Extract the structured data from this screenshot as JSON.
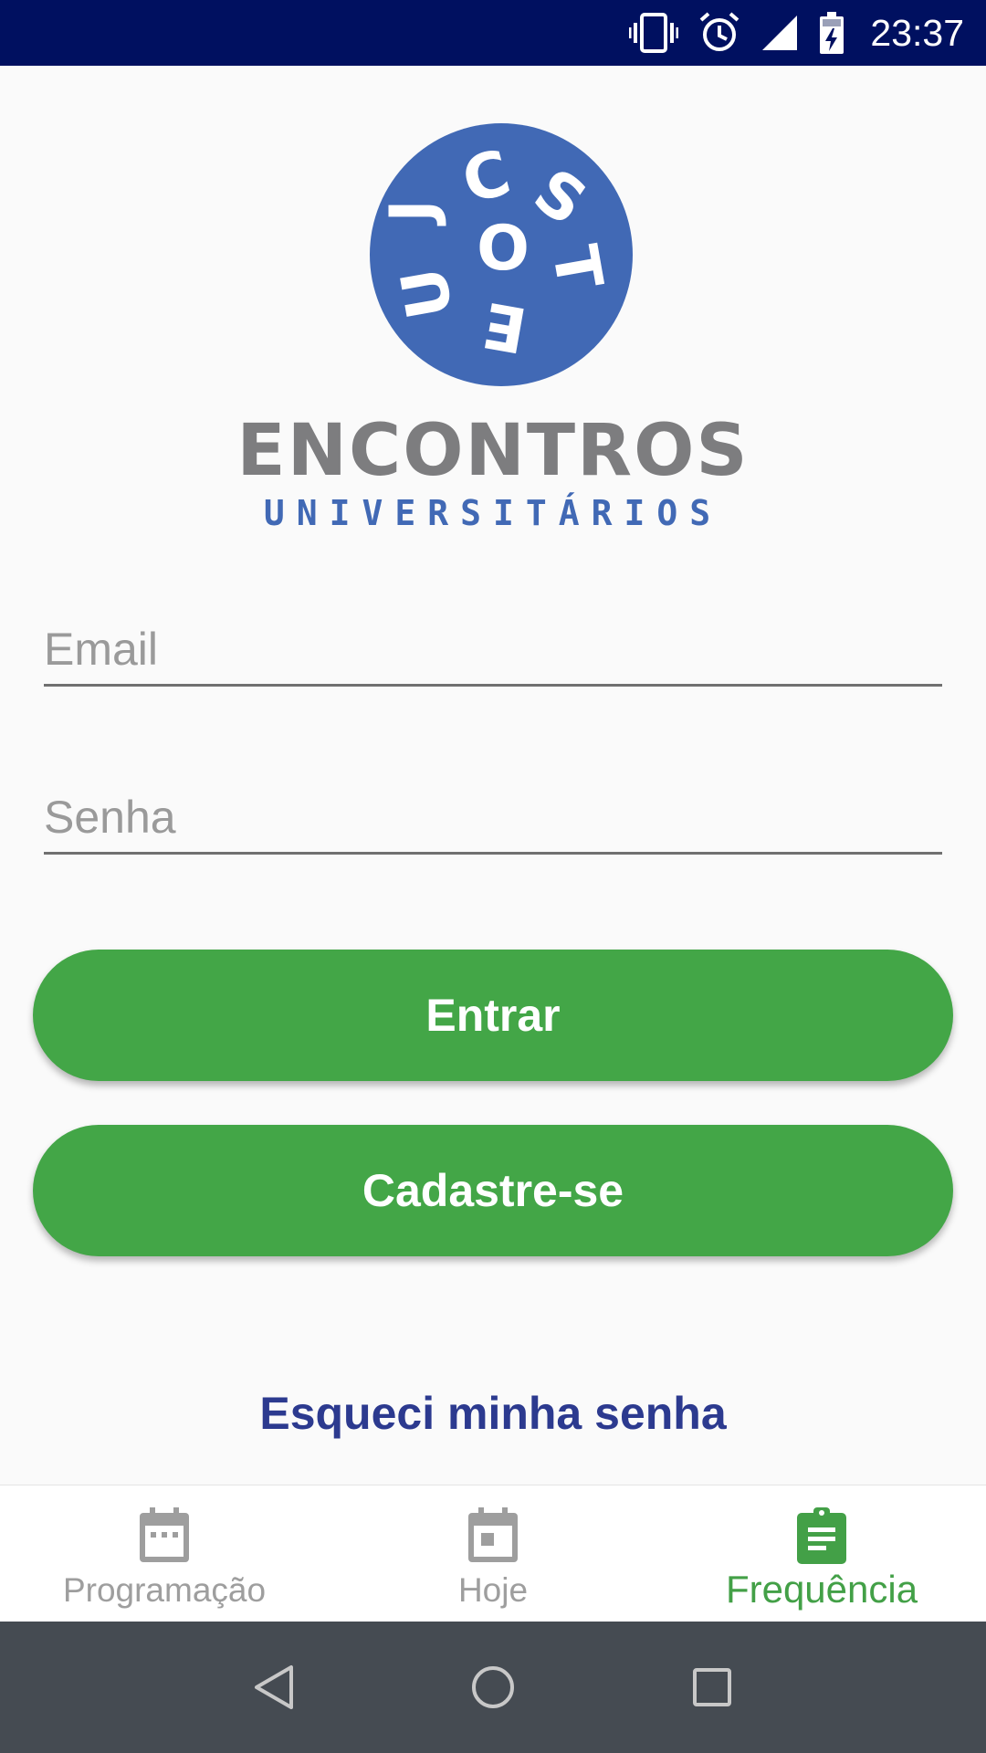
{
  "status_bar": {
    "time": "23:37",
    "bg_color": "#001060",
    "icons": [
      "vibrate-icon",
      "alarm-icon",
      "signal-icon",
      "battery-charging-icon"
    ]
  },
  "logo": {
    "circle_color": "#4169b5",
    "letters": "JCSOUTE",
    "title": "ENCONTROS",
    "subtitle": "UNIVERSITÁRIOS"
  },
  "form": {
    "email_placeholder": "Email",
    "email_value": "",
    "password_placeholder": "Senha",
    "password_value": ""
  },
  "buttons": {
    "login_label": "Entrar",
    "signup_label": "Cadastre-se",
    "forgot_label": "Esqueci minha senha",
    "accent_color": "#43a647"
  },
  "bottom_nav": {
    "items": [
      {
        "label": "Programação",
        "icon": "calendar-icon",
        "active": false
      },
      {
        "label": "Hoje",
        "icon": "calendar-today-icon",
        "active": false
      },
      {
        "label": "Frequência",
        "icon": "clipboard-icon",
        "active": true
      }
    ],
    "active_color": "#43a047",
    "inactive_color": "#9e9e9e"
  },
  "system_nav": {
    "icons": [
      "back-icon",
      "home-icon",
      "recents-icon"
    ]
  }
}
